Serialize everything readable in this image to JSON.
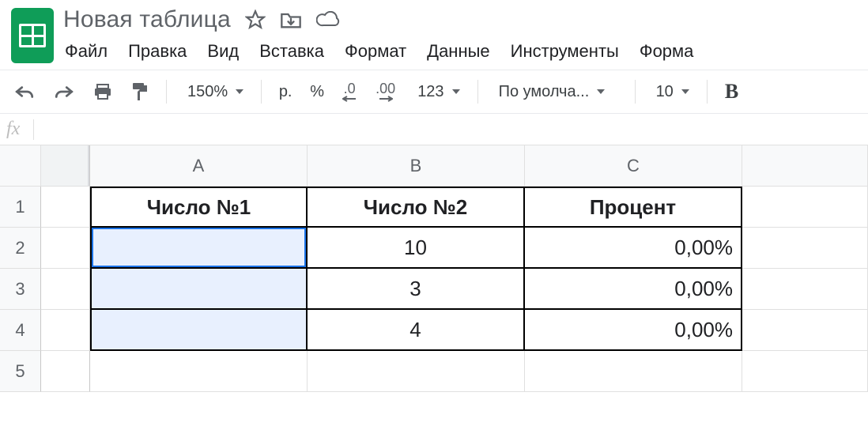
{
  "app": {
    "doc_title": "Новая таблица"
  },
  "menu": {
    "file": "Файл",
    "edit": "Правка",
    "view": "Вид",
    "insert": "Вставка",
    "format": "Формат",
    "data": "Данные",
    "tools": "Инструменты",
    "form": "Форма"
  },
  "toolbar": {
    "zoom": "150%",
    "currency": "р.",
    "percent": "%",
    "dec_less": ".0",
    "dec_more": ".00",
    "more_formats": "123",
    "font": "По умолча...",
    "font_size": "10",
    "bold": "B"
  },
  "formula": {
    "label": "fx",
    "value": ""
  },
  "columns": [
    "A",
    "B",
    "C"
  ],
  "rows": [
    "1",
    "2",
    "3",
    "4",
    "5"
  ],
  "headers": {
    "A": "Число №1",
    "B": "Число №2",
    "C": "Процент"
  },
  "data": {
    "r2": {
      "A": "",
      "B": "10",
      "C": "0,00%"
    },
    "r3": {
      "A": "",
      "B": "3",
      "C": "0,00%"
    },
    "r4": {
      "A": "",
      "B": "4",
      "C": "0,00%"
    }
  },
  "selection": "A2:A4"
}
